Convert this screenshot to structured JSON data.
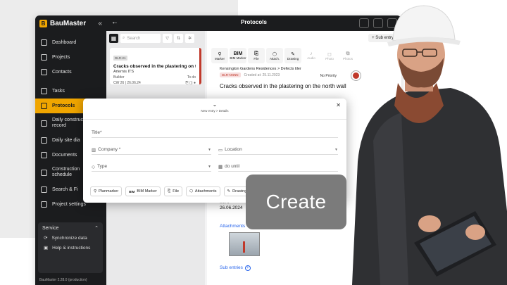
{
  "sidebar": {
    "brand": "BauMaster",
    "collapse_glyph": "«",
    "items": [
      {
        "label": "Dashboard",
        "icon": "dashboard-icon"
      },
      {
        "label": "Projects",
        "icon": "list-icon"
      },
      {
        "label": "Contacts",
        "icon": "user-icon"
      },
      {
        "label": "Tasks",
        "icon": "clipboard-icon"
      },
      {
        "label": "Protocols",
        "icon": "document-icon",
        "active": true
      },
      {
        "label": "Daily construction record",
        "icon": "notebook-icon"
      },
      {
        "label": "Daily site dia",
        "icon": "calendar-icon"
      },
      {
        "label": "Documents",
        "icon": "folder-icon"
      },
      {
        "label": "Construction schedule",
        "icon": "gantt-icon"
      },
      {
        "label": "Search & Fi",
        "icon": "search-icon"
      },
      {
        "label": "Project settings",
        "icon": "sliders-icon"
      }
    ],
    "service": {
      "title": "Service",
      "items": [
        {
          "label": "Synchronize data",
          "icon": "sync-icon"
        },
        {
          "label": "Help & instructions",
          "icon": "help-icon"
        }
      ]
    },
    "version": "BauMaster 2.28.0 (production)",
    "accent": "#f0a500"
  },
  "topbar": {
    "title": "Protocols",
    "back_glyph": "←"
  },
  "list": {
    "search_placeholder": "Search",
    "card": {
      "tag": "DLR-21",
      "title": "Cracks observed in the plastering on th...",
      "company": "Arternis ITS",
      "trade": "Builder",
      "status": "To do",
      "week": "CW 26 | 26.06.24"
    }
  },
  "detail": {
    "sub_entry_label": "+ Sub entry",
    "tools": [
      {
        "label": "Marker",
        "glyph": "⚲"
      },
      {
        "label": "BIM Marker",
        "glyph": "BIM"
      },
      {
        "label": "File",
        "glyph": "⎘"
      },
      {
        "label": "Attach.",
        "glyph": "⬡"
      },
      {
        "label": "Drawing",
        "glyph": "✎"
      },
      {
        "label": "Audio",
        "glyph": "♪",
        "dim": true
      },
      {
        "label": "Photo",
        "glyph": "◻",
        "dim": true
      },
      {
        "label": "Photos",
        "glyph": "⧉",
        "dim": true
      }
    ],
    "breadcrumb": "Kensington Gardens Residences > Defects tiler",
    "status_badge": "DLR-NNNN",
    "created": "Created at: 25.11.2023",
    "priority": "No Priority",
    "title": "Cracks observed in the plastering on the north wall",
    "date_label": "Due d",
    "date_value": "26.06.2024",
    "attachments_label": "Attachments",
    "sub_entries_label": "Sub entries"
  },
  "modal": {
    "breadcrumb": "New entry > Details",
    "title_placeholder": "Title*",
    "company_placeholder": "Company *",
    "location_placeholder": "Location",
    "type_placeholder": "Type",
    "do_until_placeholder": "do until",
    "chips": [
      {
        "label": "Planmarker",
        "icon": "pin-icon",
        "glyph": "⚲"
      },
      {
        "label": "BIM Marker",
        "icon": "bim-icon",
        "glyph": "BIM"
      },
      {
        "label": "File",
        "icon": "file-icon",
        "glyph": "⎘"
      },
      {
        "label": "Attachments",
        "icon": "attachment-icon",
        "glyph": "⬡"
      },
      {
        "label": "Drawing",
        "icon": "drawing-icon",
        "glyph": "✎"
      }
    ]
  },
  "cta": {
    "label": "Create"
  }
}
